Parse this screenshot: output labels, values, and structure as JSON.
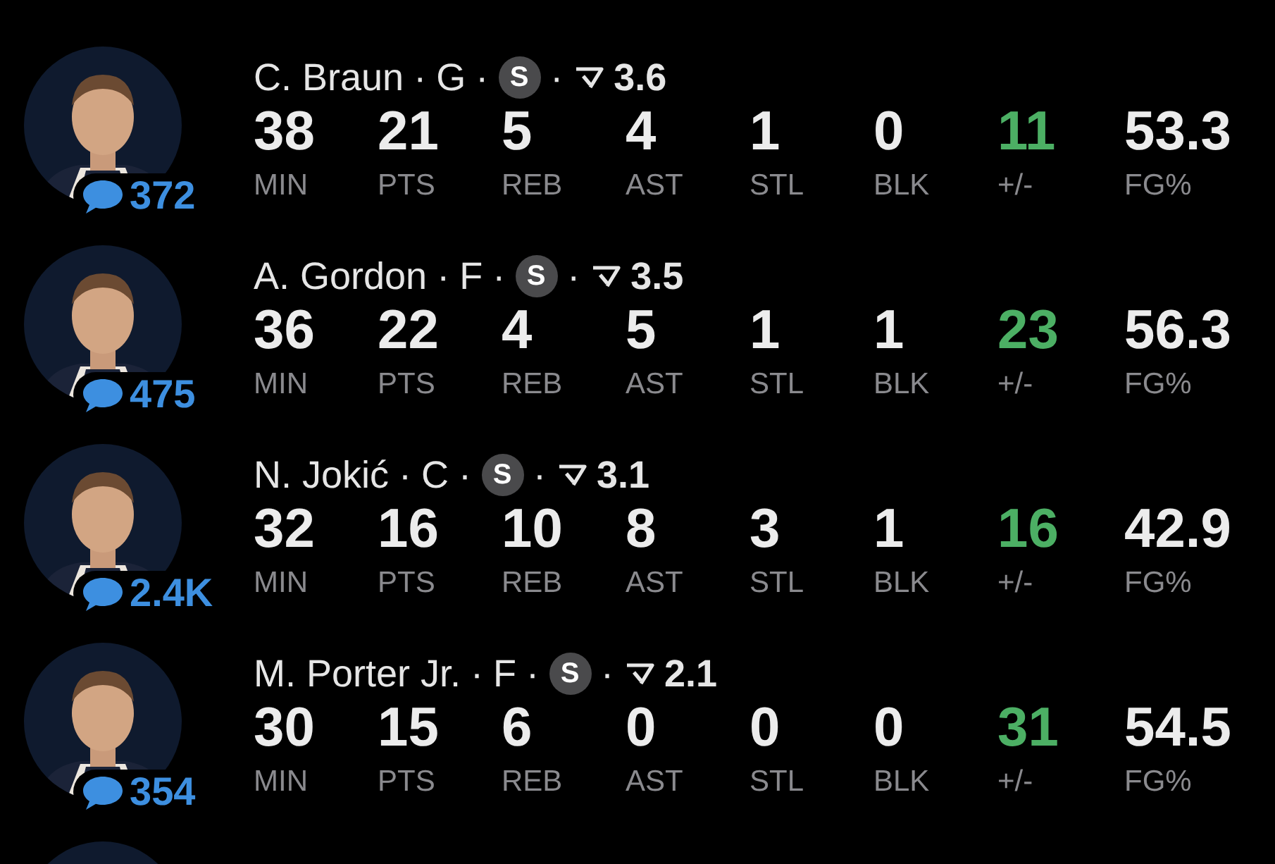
{
  "separator": "·",
  "players": [
    {
      "avatar": {
        "kind": "picture"
      },
      "name": "C. Braun",
      "position": "G",
      "badge": "S",
      "rating": "3.6",
      "comments": "372",
      "stats": [
        {
          "value": "38",
          "label": "MIN"
        },
        {
          "value": "21",
          "label": "PTS"
        },
        {
          "value": "5",
          "label": "REB"
        },
        {
          "value": "4",
          "label": "AST"
        },
        {
          "value": "1",
          "label": "STL"
        },
        {
          "value": "0",
          "label": "BLK"
        },
        {
          "value": "11",
          "label": "+/-",
          "color": "#4caf64"
        },
        {
          "value": "53.3",
          "label": "FG%"
        }
      ]
    },
    {
      "avatar": {
        "kind": "picture"
      },
      "name": "A. Gordon",
      "position": "F",
      "badge": "S",
      "rating": "3.5",
      "comments": "475",
      "stats": [
        {
          "value": "36",
          "label": "MIN"
        },
        {
          "value": "22",
          "label": "PTS"
        },
        {
          "value": "4",
          "label": "REB"
        },
        {
          "value": "5",
          "label": "AST"
        },
        {
          "value": "1",
          "label": "STL"
        },
        {
          "value": "1",
          "label": "BLK"
        },
        {
          "value": "23",
          "label": "+/-",
          "color": "#4caf64"
        },
        {
          "value": "56.3",
          "label": "FG%"
        }
      ]
    },
    {
      "avatar": {
        "kind": "picture"
      },
      "name": "N. Jokić",
      "position": "C",
      "badge": "S",
      "rating": "3.1",
      "comments": "2.4K",
      "stats": [
        {
          "value": "32",
          "label": "MIN"
        },
        {
          "value": "16",
          "label": "PTS"
        },
        {
          "value": "10",
          "label": "REB"
        },
        {
          "value": "8",
          "label": "AST"
        },
        {
          "value": "3",
          "label": "STL"
        },
        {
          "value": "1",
          "label": "BLK"
        },
        {
          "value": "16",
          "label": "+/-",
          "color": "#4caf64"
        },
        {
          "value": "42.9",
          "label": "FG%"
        }
      ]
    },
    {
      "avatar": {
        "kind": "picture"
      },
      "name": "M. Porter Jr.",
      "position": "F",
      "badge": "S",
      "rating": "2.1",
      "comments": "354",
      "stats": [
        {
          "value": "30",
          "label": "MIN"
        },
        {
          "value": "15",
          "label": "PTS"
        },
        {
          "value": "6",
          "label": "REB"
        },
        {
          "value": "0",
          "label": "AST"
        },
        {
          "value": "0",
          "label": "STL"
        },
        {
          "value": "0",
          "label": "BLK"
        },
        {
          "value": "31",
          "label": "+/-",
          "color": "#4caf64"
        },
        {
          "value": "54.5",
          "label": "FG%"
        }
      ]
    },
    {
      "avatar": {
        "kind": "picture"
      }
    }
  ]
}
